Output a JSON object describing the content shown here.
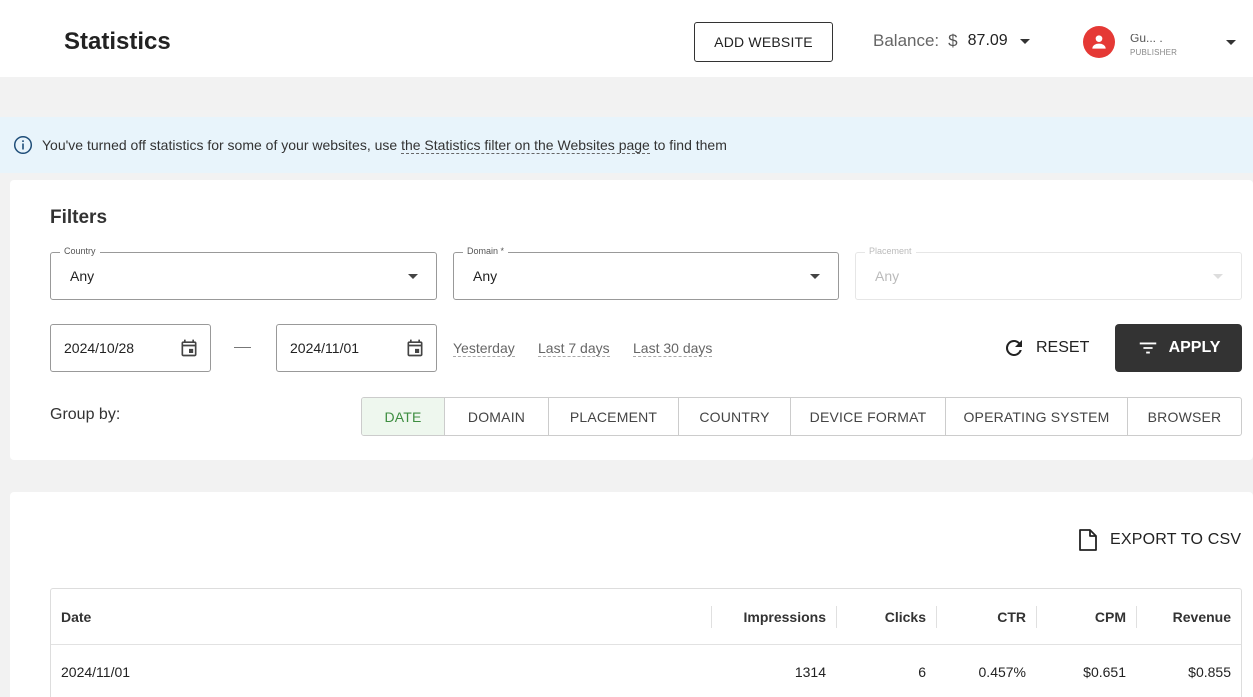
{
  "header": {
    "title": "Statistics",
    "add_website_label": "ADD WEBSITE",
    "balance_label": "Balance:",
    "currency": "$",
    "balance_amount": "87.09",
    "user_name": "Gu... .",
    "user_role": "PUBLISHER"
  },
  "banner": {
    "text_before": "You've turned off statistics for some of your websites, use ",
    "link_text": "the Statistics filter on the Websites page",
    "text_after": " to find them"
  },
  "filters": {
    "title": "Filters",
    "country": {
      "label": "Country",
      "value": "Any"
    },
    "domain": {
      "label": "Domain *",
      "value": "Any"
    },
    "placement": {
      "label": "Placement",
      "value": "Any",
      "disabled": true
    },
    "date_from": "2024/10/28",
    "date_to": "2024/11/01",
    "quick_ranges": [
      "Yesterday",
      "Last 7 days",
      "Last 30 days"
    ],
    "reset_label": "RESET",
    "apply_label": "APPLY",
    "group_by_label": "Group by:",
    "group_by_options": [
      "DATE",
      "DOMAIN",
      "PLACEMENT",
      "COUNTRY",
      "DEVICE FORMAT",
      "OPERATING SYSTEM",
      "BROWSER"
    ],
    "group_by_selected": "DATE"
  },
  "table": {
    "export_label": "EXPORT TO CSV",
    "columns": [
      "Date",
      "Impressions",
      "Clicks",
      "CTR",
      "CPM",
      "Revenue"
    ],
    "rows": [
      [
        "2024/11/01",
        "1314",
        "6",
        "0.457%",
        "$0.651",
        "$0.855"
      ]
    ]
  },
  "colors": {
    "accent_dark": "#333333",
    "avatar": "#e53935",
    "active_tab_text": "#3e8e41",
    "banner_bg": "#e8f4fb"
  }
}
